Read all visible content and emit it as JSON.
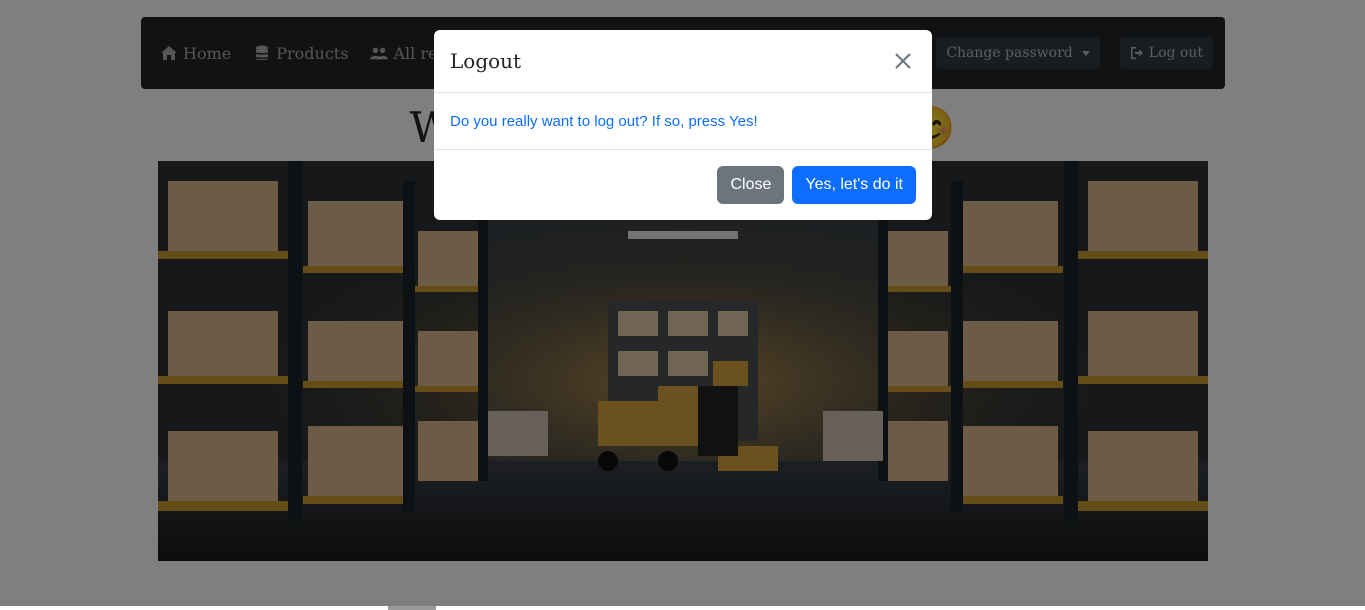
{
  "navbar": {
    "links": [
      {
        "label": "Home",
        "icon": "home-icon"
      },
      {
        "label": "Products",
        "icon": "database-icon"
      },
      {
        "label": "All regis",
        "icon": "users-icon"
      }
    ],
    "change_password": "Change password",
    "logout": "Log out"
  },
  "page": {
    "welcome_visible_start": "W",
    "welcome_visible_end": "😊",
    "hero_image": "warehouse shelves with forklift"
  },
  "modal": {
    "title": "Logout",
    "body": "Do you really want to log out? If so, press Yes!",
    "close_label": "Close",
    "confirm_label": "Yes, let's do it"
  },
  "colors": {
    "navbar": "#212529",
    "primary": "#0d6efd",
    "secondary": "#6c757d"
  }
}
